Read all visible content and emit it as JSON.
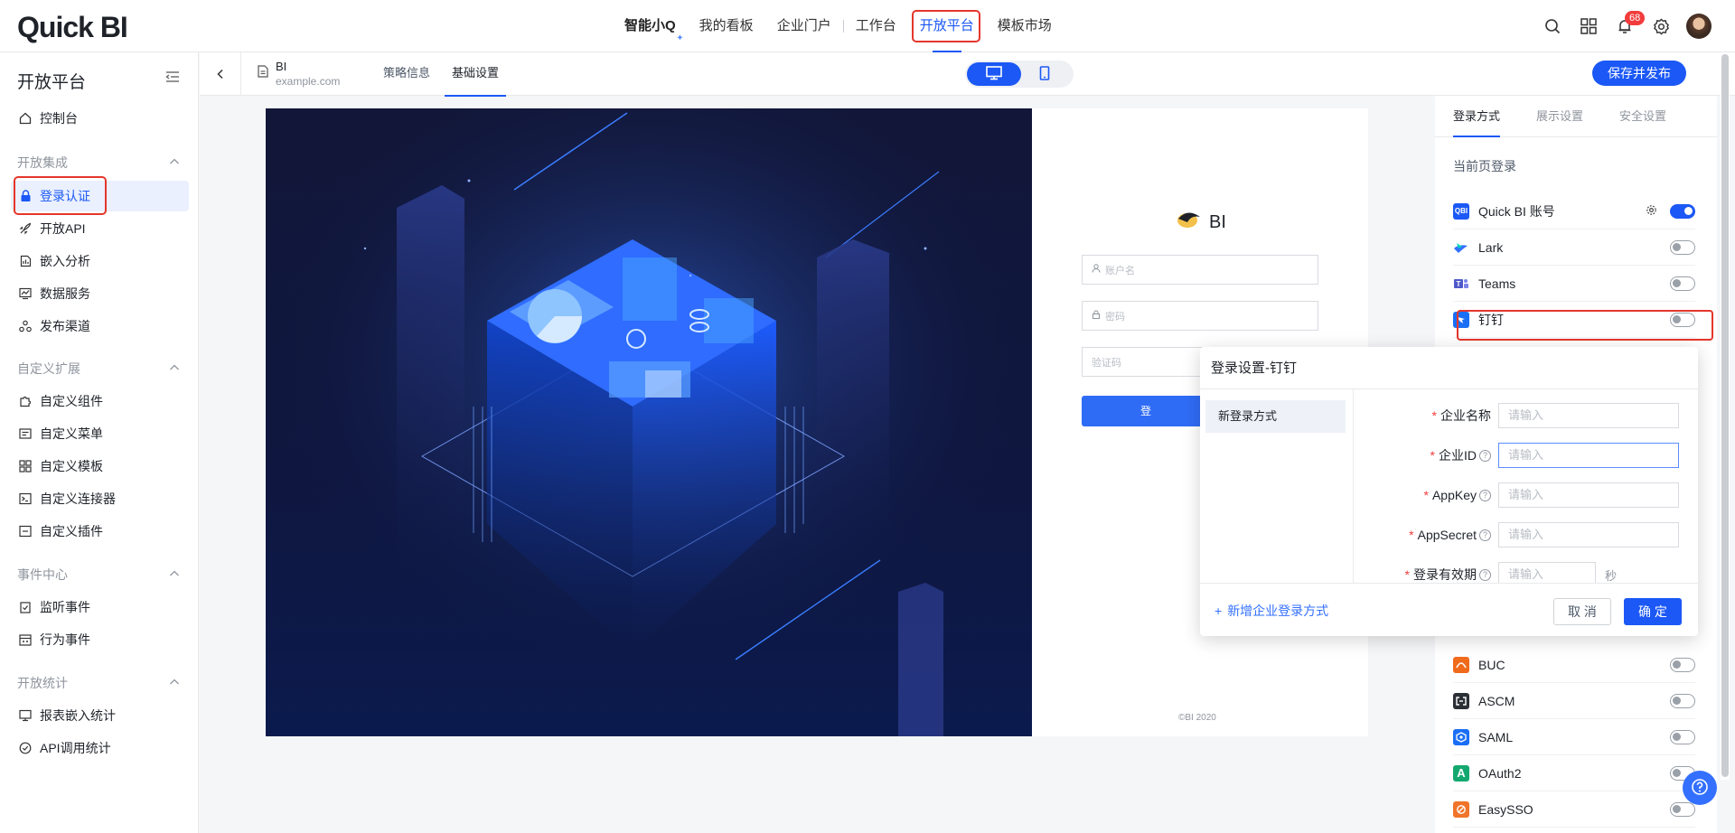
{
  "app": {
    "logo": "Quick BI"
  },
  "topnav": {
    "items": [
      "智能小Q",
      "我的看板",
      "企业门户",
      "工作台",
      "开放平台",
      "模板市场"
    ],
    "notification_count": "68"
  },
  "sidebar": {
    "title": "开放平台",
    "items": [
      {
        "label": "控制台"
      },
      {
        "section": "开放集成"
      },
      {
        "label": "登录认证"
      },
      {
        "label": "开放API"
      },
      {
        "label": "嵌入分析"
      },
      {
        "label": "数据服务"
      },
      {
        "label": "发布渠道"
      },
      {
        "section": "自定义扩展"
      },
      {
        "label": "自定义组件"
      },
      {
        "label": "自定义菜单"
      },
      {
        "label": "自定义模板"
      },
      {
        "label": "自定义连接器"
      },
      {
        "label": "自定义插件"
      },
      {
        "section": "事件中心"
      },
      {
        "label": "监听事件"
      },
      {
        "label": "行为事件"
      },
      {
        "section": "开放统计"
      },
      {
        "label": "报表嵌入统计"
      },
      {
        "label": "API调用统计"
      }
    ]
  },
  "subheader": {
    "doc_name": "BI",
    "doc_url": "example.com",
    "tabs": [
      "策略信息",
      "基础设置"
    ],
    "publish_label": "保存并发布"
  },
  "preview": {
    "brand": "BI",
    "username_placeholder": "账户名",
    "password_placeholder": "密码",
    "captcha_placeholder": "验证码",
    "login_button": "登",
    "copyright": "©BI 2020"
  },
  "rpanel": {
    "tabs": [
      "登录方式",
      "展示设置",
      "安全设置"
    ],
    "subtitle": "当前页登录",
    "methods": [
      {
        "name": "Quick BI 账号",
        "icon": "QBI",
        "color": "#1b58f5",
        "enabled": true
      },
      {
        "name": "Lark",
        "icon": "lark-icon",
        "color": "#1b58f5",
        "enabled": false
      },
      {
        "name": "Teams",
        "icon": "teams-icon",
        "color": "#5059c9",
        "enabled": false
      },
      {
        "name": "钉钉",
        "icon": "dingtalk-icon",
        "color": "#1b6ff5",
        "enabled": false
      },
      {
        "name": "BUC",
        "icon": "buc-icon",
        "color": "#f06a1c",
        "enabled": false
      },
      {
        "name": "ASCM",
        "icon": "ascm-icon",
        "color": "#2b2f36",
        "enabled": false
      },
      {
        "name": "SAML",
        "icon": "saml-icon",
        "color": "#1b6ff5",
        "enabled": false
      },
      {
        "name": "OAuth2",
        "icon": "A",
        "color": "#14a870",
        "enabled": false
      },
      {
        "name": "EasySSO",
        "icon": "easysso-icon",
        "color": "#f0742a",
        "enabled": false
      }
    ]
  },
  "dialog": {
    "title": "登录设置-钉钉",
    "left_item": "新登录方式",
    "fields": [
      {
        "label": "企业名称",
        "placeholder": "请输入",
        "help": false
      },
      {
        "label": "企业ID",
        "placeholder": "请输入",
        "help": true
      },
      {
        "label": "AppKey",
        "placeholder": "请输入",
        "help": true
      },
      {
        "label": "AppSecret",
        "placeholder": "请输入",
        "help": true
      },
      {
        "label": "登录有效期",
        "placeholder": "请输入",
        "help": true,
        "suffix": "秒"
      }
    ],
    "add_link": "新增企业登录方式",
    "cancel": "取 消",
    "ok": "确 定"
  }
}
